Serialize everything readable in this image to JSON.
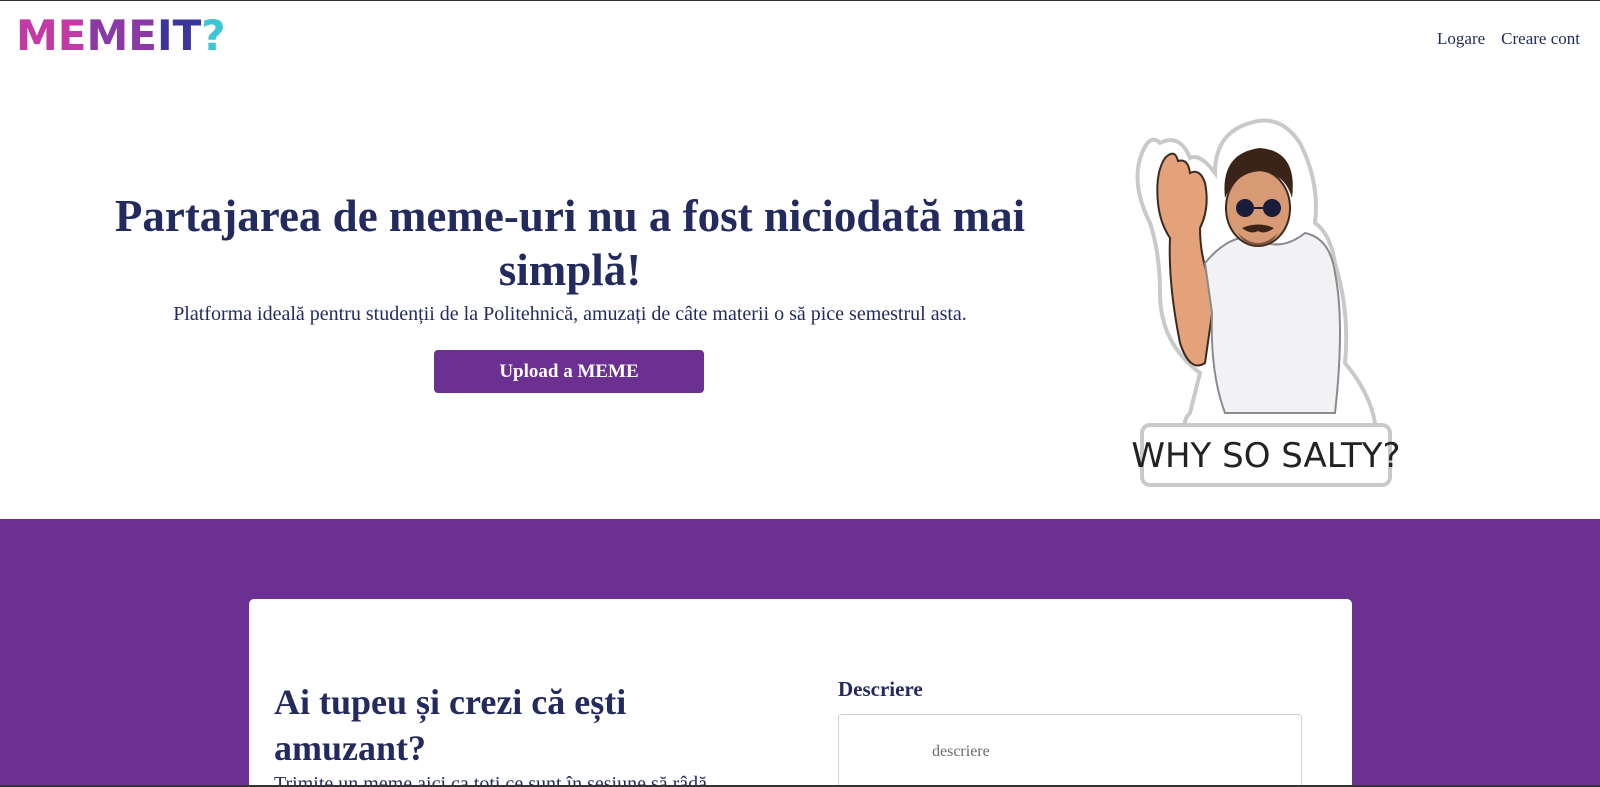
{
  "header": {
    "logo": {
      "part1": "ME",
      "part2": "ME",
      "part3": "IT",
      "part4": "?"
    },
    "nav": {
      "login": "Logare",
      "register": "Creare cont"
    }
  },
  "hero": {
    "title": "Partajarea de meme-uri nu a fost niciodată mai simplă!",
    "subtitle": "Platforma ideală pentru studenții de la Politehnică, amuzați de câte materii o să pice semestrul asta.",
    "upload_button": "Upload a MEME",
    "sticker_caption": "WHY SO SALTY?"
  },
  "upload_card": {
    "title": "Ai tupeu și crezi că ești amuzant?",
    "text_partial": "Trimite un meme aici ca toți ce sunt în sesiune să râdă",
    "description_label": "Descriere",
    "description_placeholder": "descriere"
  },
  "colors": {
    "brand_purple": "#6c2f92",
    "navy_text": "#232b5e",
    "logo_pink": "#c23aa5",
    "logo_cyan": "#3fc6d6"
  }
}
